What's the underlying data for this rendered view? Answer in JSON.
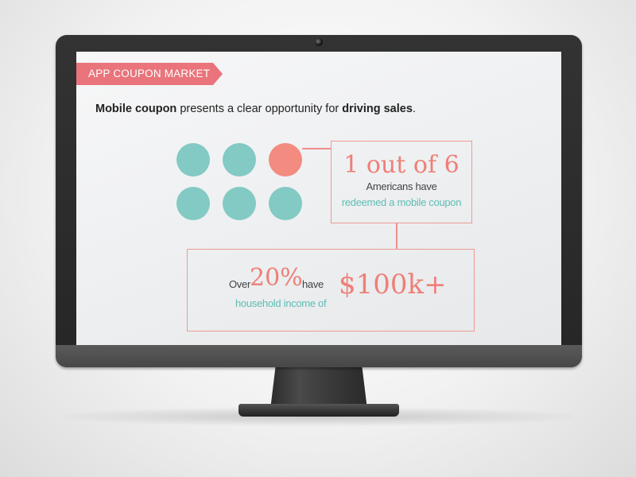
{
  "ribbon": {
    "label": "APP COUPON MARKET"
  },
  "headline": {
    "part1": "Mobile coupon",
    "part2": " presents a clear opportunity for ",
    "part3": "driving sales",
    "part4": "."
  },
  "stat1": {
    "value": "1 out of 6",
    "line1": "Americans have",
    "line2": "redeemed a mobile coupon"
  },
  "stat2": {
    "prefix": "Over",
    "percent": "20%",
    "suffix": "have",
    "line2": "household income of",
    "amount": "$100k+"
  },
  "icons": {
    "dots_total": 6,
    "dots_highlighted": 1
  },
  "colors": {
    "accent_coral": "#ef7f77",
    "teal": "#82cac3",
    "ribbon": "#e9747b"
  }
}
